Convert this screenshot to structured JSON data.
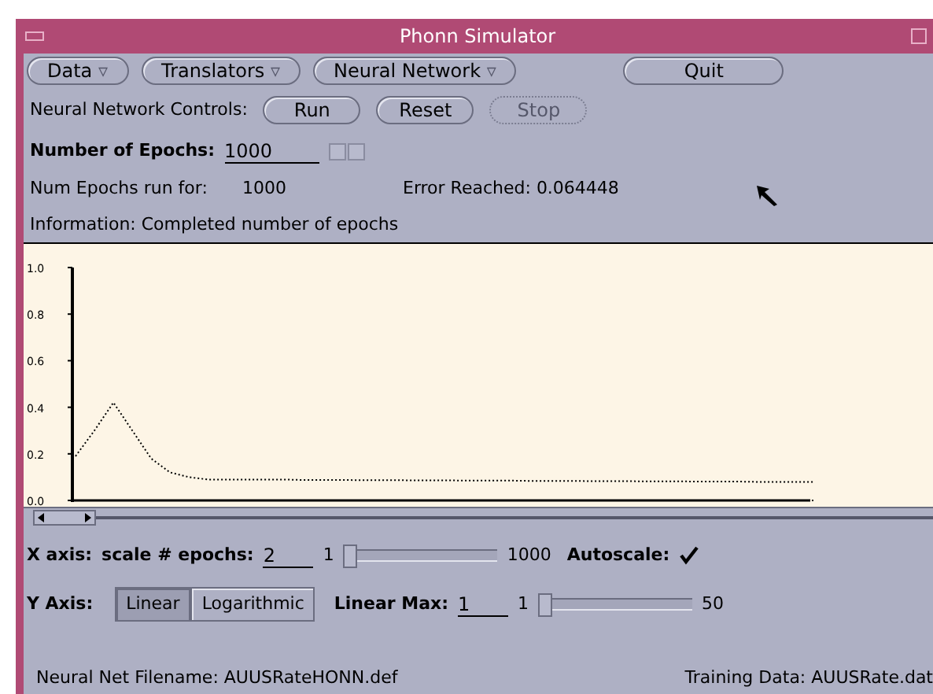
{
  "window": {
    "title": "Phonn Simulator"
  },
  "menus": [
    {
      "label": "Data",
      "glyph": "▿"
    },
    {
      "label": "Translators",
      "glyph": "▿"
    },
    {
      "label": "Neural Network",
      "glyph": "▿"
    }
  ],
  "quit_button": "Quit",
  "controls": {
    "label": "Neural Network Controls:",
    "buttons": [
      {
        "label": "Run",
        "disabled": false
      },
      {
        "label": "Reset",
        "disabled": false
      },
      {
        "label": "Stop",
        "disabled": true
      }
    ]
  },
  "epochs": {
    "label": "Number of Epochs:",
    "value": "1000"
  },
  "status": {
    "run_label": "Num Epochs run for:",
    "run_value": "1000",
    "error": "Error Reached: 0.064448",
    "information": "Information: Completed number of epochs"
  },
  "chart_data": {
    "type": "line",
    "ylim": [
      0,
      1
    ],
    "yticks": [
      {
        "value": 0,
        "label": "0.0"
      },
      {
        "value": 0.2,
        "label": "0.2"
      },
      {
        "value": 0.4,
        "label": "0.4"
      },
      {
        "value": 0.6,
        "label": "0.6"
      },
      {
        "value": 0.8,
        "label": "0.8"
      },
      {
        "value": 1,
        "label": "1.0"
      }
    ],
    "series": [
      {
        "color": "#000000",
        "line_style": "dotted",
        "values": [
          0.19,
          0.3,
          0.42,
          0.3,
          0.18,
          0.12,
          0.1,
          0.09,
          0.09,
          0.09,
          0.09,
          0.09,
          0.088,
          0.088,
          0.088,
          0.087,
          0.087,
          0.087,
          0.086,
          0.086,
          0.086,
          0.085,
          0.085,
          0.085,
          0.084,
          0.084,
          0.084,
          0.083,
          0.083,
          0.083,
          0.082,
          0.082,
          0.082,
          0.081,
          0.081,
          0.081,
          0.08,
          0.08,
          0.08,
          0.08
        ]
      },
      {
        "color": "#000000",
        "line_style": "dashed",
        "values": [
          0,
          0,
          0,
          0,
          0,
          0,
          0,
          0,
          0,
          0,
          0,
          0,
          0,
          0,
          0,
          0,
          0,
          0,
          0,
          0,
          0,
          0,
          0,
          0,
          0,
          0,
          0,
          0,
          0,
          0,
          0,
          0,
          0,
          0,
          0,
          0,
          0,
          0,
          0,
          0
        ]
      }
    ]
  },
  "x_axis": {
    "label": "X axis:",
    "scale_label": "scale # epochs:",
    "value": "2",
    "min": "1",
    "max": "1000",
    "level": 0,
    "autoscale_label": "Autoscale:",
    "autoscale": true
  },
  "y_axis": {
    "label": "Y Axis:",
    "modes": [
      {
        "label": "Linear",
        "selected": true
      },
      {
        "label": "Logarithmic",
        "selected": false
      }
    ],
    "max_label": "Linear Max:",
    "max_value": "1",
    "min": "1",
    "max": "50",
    "level": 0
  },
  "footer": {
    "filename": "Neural Net Filename: AUUSRateHONN.def",
    "training": "Training Data: AUUSRate.dat"
  }
}
